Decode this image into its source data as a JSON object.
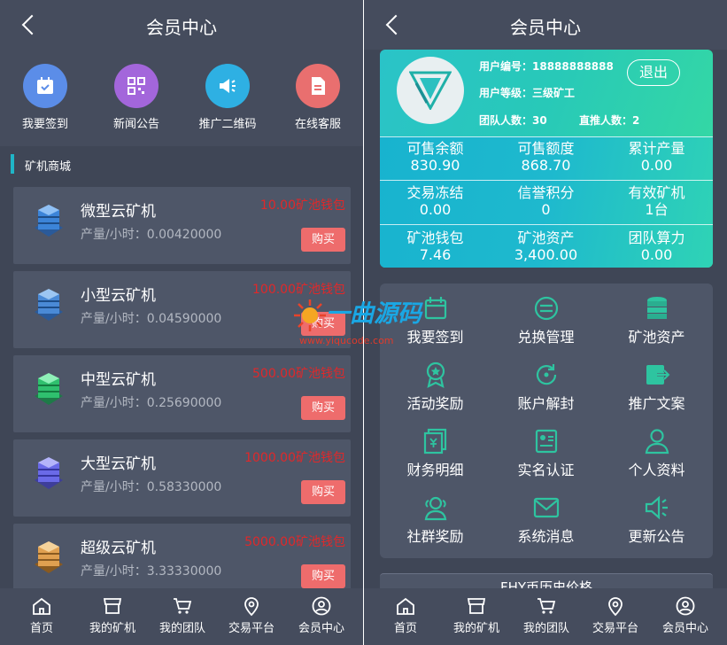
{
  "left": {
    "title": "会员中心",
    "quick": [
      {
        "label": "我要签到",
        "icon": "calendar-check-icon",
        "color": "#5b8de8"
      },
      {
        "label": "新闻公告",
        "icon": "qr-code-icon",
        "color": "#a366db"
      },
      {
        "label": "推广二维码",
        "icon": "megaphone-icon",
        "color": "#2eb0e3"
      },
      {
        "label": "在线客服",
        "icon": "document-icon",
        "color": "#e96f6f"
      }
    ],
    "section_title": "矿机商城",
    "machines": [
      {
        "name": "微型云矿机",
        "rate": "产量/小时：0.00420000",
        "price": "10.00矿池钱包",
        "buy": "购买",
        "color": "#3c84d8"
      },
      {
        "name": "小型云矿机",
        "rate": "产量/小时：0.04590000",
        "price": "100.00矿池钱包",
        "buy": "购买",
        "color": "#4a8ad6"
      },
      {
        "name": "中型云矿机",
        "rate": "产量/小时：0.25690000",
        "price": "500.00矿池钱包",
        "buy": "购买",
        "color": "#2fc06e"
      },
      {
        "name": "大型云矿机",
        "rate": "产量/小时：0.58330000",
        "price": "1000.00矿池钱包",
        "buy": "购买",
        "color": "#6a6ae8"
      },
      {
        "name": "超级云矿机",
        "rate": "产量/小时：3.33330000",
        "price": "5000.00矿池钱包",
        "buy": "购买",
        "color": "#e0a050"
      }
    ]
  },
  "right": {
    "title": "会员中心",
    "user_id": "用户编号：18888888888",
    "user_level": "用户等级：三级矿工",
    "team_count": "团队人数：30",
    "direct_count": "直推人数：2",
    "logout": "退出",
    "stats": [
      {
        "label": "可售余额",
        "value": "830.90"
      },
      {
        "label": "可售额度",
        "value": "868.70"
      },
      {
        "label": "累计产量",
        "value": "0.00"
      },
      {
        "label": "交易冻结",
        "value": "0.00"
      },
      {
        "label": "信誉积分",
        "value": "0"
      },
      {
        "label": "有效矿机",
        "value": "1台"
      },
      {
        "label": "矿池钱包",
        "value": "7.46"
      },
      {
        "label": "矿池资产",
        "value": "3,400.00"
      },
      {
        "label": "团队算力",
        "value": "0.00"
      }
    ],
    "menu": [
      {
        "label": "我要签到",
        "icon": "calendar-icon"
      },
      {
        "label": "兑换管理",
        "icon": "exchange-icon"
      },
      {
        "label": "矿池资产",
        "icon": "coins-icon"
      },
      {
        "label": "活动奖励",
        "icon": "award-icon"
      },
      {
        "label": "账户解封",
        "icon": "unlock-icon"
      },
      {
        "label": "推广文案",
        "icon": "share-icon"
      },
      {
        "label": "财务明细",
        "icon": "finance-icon"
      },
      {
        "label": "实名认证",
        "icon": "id-card-icon"
      },
      {
        "label": "个人资料",
        "icon": "user-icon"
      },
      {
        "label": "社群奖励",
        "icon": "group-icon"
      },
      {
        "label": "系统消息",
        "icon": "mail-icon"
      },
      {
        "label": "更新公告",
        "icon": "speaker-icon"
      }
    ],
    "price_title": "FHY币历史价格"
  },
  "tabs": [
    {
      "label": "首页",
      "icon": "home-icon"
    },
    {
      "label": "我的矿机",
      "icon": "store-icon"
    },
    {
      "label": "我的团队",
      "icon": "cart-icon"
    },
    {
      "label": "交易平台",
      "icon": "location-pin-icon"
    },
    {
      "label": "会员中心",
      "icon": "profile-icon"
    }
  ],
  "watermark": {
    "text": "一曲源码",
    "url": "www.yiqucode.com"
  },
  "accent": "#2ec4c0"
}
